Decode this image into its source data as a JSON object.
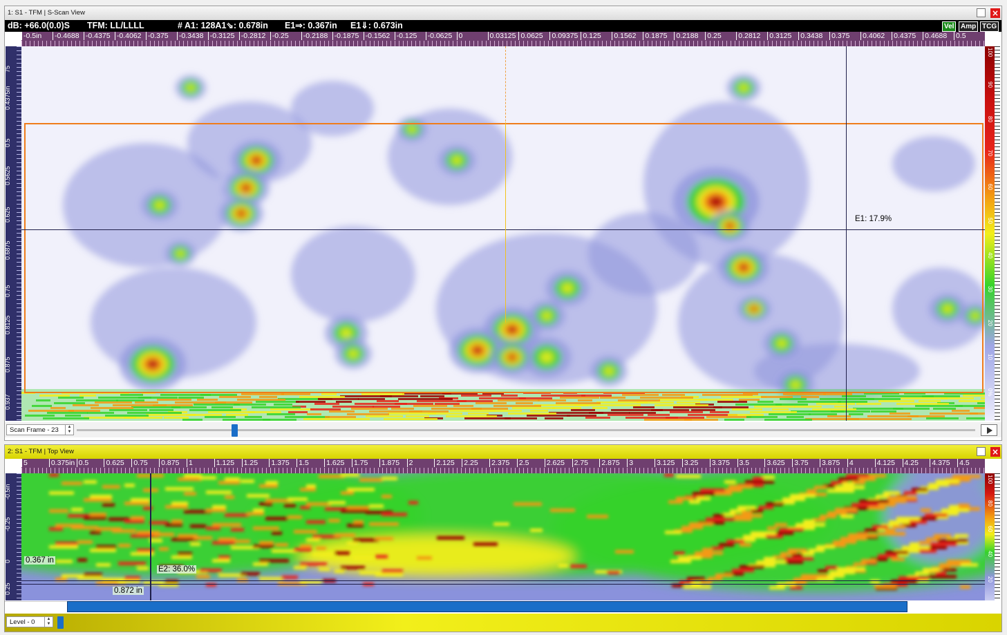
{
  "top_panel": {
    "title": "1: S1 - TFM | S-Scan View",
    "info": {
      "db": "dB: +66.0(0.0)S",
      "tfm": "TFM: LL/LLLL",
      "a1": "# A1: 128A1⇘: 0.678in",
      "e1_right": "E1⇒: 0.367in",
      "e1_down": "E1⇓: 0.673in"
    },
    "modes": [
      "Vel",
      "Amp",
      "TCG"
    ],
    "x_ruler_labels": [
      "-0.5in",
      "-0.4688",
      "-0.4375",
      "-0.4062",
      "-0.375",
      "-0.3438",
      "-0.3125",
      "-0.2812",
      "-0.25",
      "-0.2188",
      "-0.1875",
      "-0.1562",
      "-0.125",
      "-0.0625",
      "0",
      "0.03125",
      "0.0625",
      "0.09375",
      "0.125",
      "0.1562",
      "0.1875",
      "0.2188",
      "0.25",
      "0.2812",
      "0.3125",
      "0.3438",
      "0.375",
      "0.4062",
      "0.4375",
      "0.4688",
      "0.5"
    ],
    "y_ruler_labels": [
      "75",
      "0.4375in",
      "0.5",
      "0.5625",
      "0.625",
      "0.6875",
      "0.75",
      "0.8125",
      "0.875",
      "0.937"
    ],
    "color_scale_labels": [
      "100",
      "90",
      "80",
      "70",
      "60",
      "50",
      "40",
      "30",
      "20",
      "10",
      "0%"
    ],
    "cursor_label": "E1: 17.9%",
    "frame_control": {
      "label": "Scan Frame - 23",
      "value": 23
    }
  },
  "bottom_panel": {
    "title": "2: S1 - TFM | Top View",
    "x_ruler_labels": [
      "5",
      "0.375in",
      "0.5",
      "0.625",
      "0.75",
      "0.875",
      "1",
      "1.125",
      "1.25",
      "1.375",
      "1.5",
      "1.625",
      "1.75",
      "1.875",
      "2",
      "2.125",
      "2.25",
      "2.375",
      "2.5",
      "2.625",
      "2.75",
      "2.875",
      "3",
      "3.125",
      "3.25",
      "3.375",
      "3.5",
      "3.625",
      "3.75",
      "3.875",
      "4",
      "4.125",
      "4.25",
      "4.375",
      "4.5"
    ],
    "y_ruler_labels": [
      "-0.5in",
      "-0.25",
      "0",
      "0.25"
    ],
    "color_scale_labels": [
      "100",
      "80",
      "60",
      "40",
      "20"
    ],
    "readout_left": "0.367 in",
    "readout_cursor": "E2: 36.0%",
    "readout_bottom": "0.872 in",
    "level_control": {
      "label": "Level - 0",
      "value": 0
    }
  },
  "colors": {
    "low": "#eeeefc",
    "lowblue": "#8f96dc",
    "green": "#35d32a",
    "yellow": "#f2ee1a",
    "orange": "#f39a12",
    "red": "#e8251a",
    "darkred": "#9c0000",
    "gate": "#ef7c1a",
    "cursor": "#1e1e4a"
  }
}
